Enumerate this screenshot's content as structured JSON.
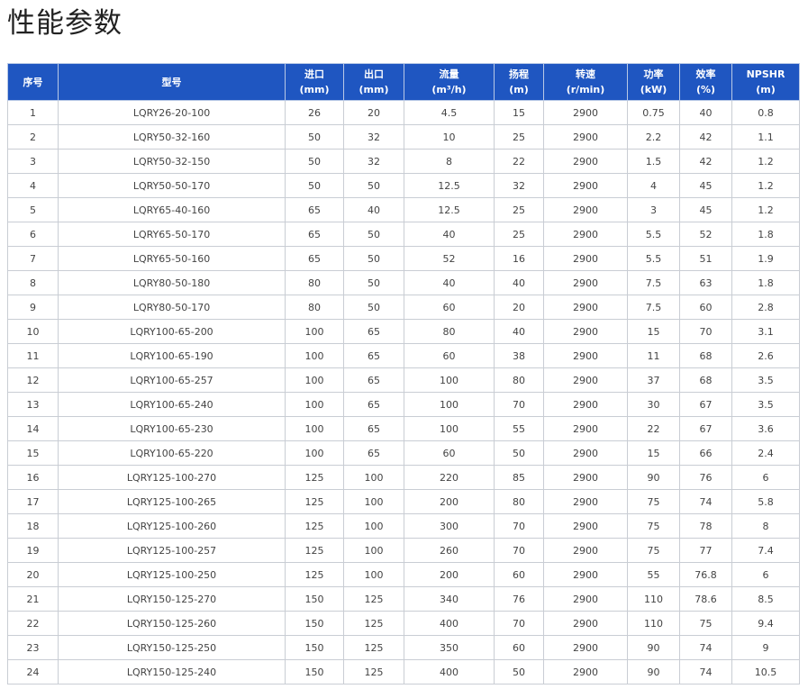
{
  "title": "性能参数",
  "columns": [
    {
      "l1": "序号",
      "l2": ""
    },
    {
      "l1": "型号",
      "l2": ""
    },
    {
      "l1": "进口",
      "l2": "(mm)"
    },
    {
      "l1": "出口",
      "l2": "(mm)"
    },
    {
      "l1": "流量",
      "l2": "(m³/h)"
    },
    {
      "l1": "扬程",
      "l2": "(m)"
    },
    {
      "l1": "转速",
      "l2": "(r/min)"
    },
    {
      "l1": "功率",
      "l2": "(kW)"
    },
    {
      "l1": "效率",
      "l2": "(%)"
    },
    {
      "l1": "NPSHR",
      "l2": "(m)"
    }
  ],
  "rows": [
    [
      "1",
      "LQRY26-20-100",
      "26",
      "20",
      "4.5",
      "15",
      "2900",
      "0.75",
      "40",
      "0.8"
    ],
    [
      "2",
      "LQRY50-32-160",
      "50",
      "32",
      "10",
      "25",
      "2900",
      "2.2",
      "42",
      "1.1"
    ],
    [
      "3",
      "LQRY50-32-150",
      "50",
      "32",
      "8",
      "22",
      "2900",
      "1.5",
      "42",
      "1.2"
    ],
    [
      "4",
      "LQRY50-50-170",
      "50",
      "50",
      "12.5",
      "32",
      "2900",
      "4",
      "45",
      "1.2"
    ],
    [
      "5",
      "LQRY65-40-160",
      "65",
      "40",
      "12.5",
      "25",
      "2900",
      "3",
      "45",
      "1.2"
    ],
    [
      "6",
      "LQRY65-50-170",
      "65",
      "50",
      "40",
      "25",
      "2900",
      "5.5",
      "52",
      "1.8"
    ],
    [
      "7",
      "LQRY65-50-160",
      "65",
      "50",
      "52",
      "16",
      "2900",
      "5.5",
      "51",
      "1.9"
    ],
    [
      "8",
      "LQRY80-50-180",
      "80",
      "50",
      "40",
      "40",
      "2900",
      "7.5",
      "63",
      "1.8"
    ],
    [
      "9",
      "LQRY80-50-170",
      "80",
      "50",
      "60",
      "20",
      "2900",
      "7.5",
      "60",
      "2.8"
    ],
    [
      "10",
      "LQRY100-65-200",
      "100",
      "65",
      "80",
      "40",
      "2900",
      "15",
      "70",
      "3.1"
    ],
    [
      "11",
      "LQRY100-65-190",
      "100",
      "65",
      "60",
      "38",
      "2900",
      "11",
      "68",
      "2.6"
    ],
    [
      "12",
      "LQRY100-65-257",
      "100",
      "65",
      "100",
      "80",
      "2900",
      "37",
      "68",
      "3.5"
    ],
    [
      "13",
      "LQRY100-65-240",
      "100",
      "65",
      "100",
      "70",
      "2900",
      "30",
      "67",
      "3.5"
    ],
    [
      "14",
      "LQRY100-65-230",
      "100",
      "65",
      "100",
      "55",
      "2900",
      "22",
      "67",
      "3.6"
    ],
    [
      "15",
      "LQRY100-65-220",
      "100",
      "65",
      "60",
      "50",
      "2900",
      "15",
      "66",
      "2.4"
    ],
    [
      "16",
      "LQRY125-100-270",
      "125",
      "100",
      "220",
      "85",
      "2900",
      "90",
      "76",
      "6"
    ],
    [
      "17",
      "LQRY125-100-265",
      "125",
      "100",
      "200",
      "80",
      "2900",
      "75",
      "74",
      "5.8"
    ],
    [
      "18",
      "LQRY125-100-260",
      "125",
      "100",
      "300",
      "70",
      "2900",
      "75",
      "78",
      "8"
    ],
    [
      "19",
      "LQRY125-100-257",
      "125",
      "100",
      "260",
      "70",
      "2900",
      "75",
      "77",
      "7.4"
    ],
    [
      "20",
      "LQRY125-100-250",
      "125",
      "100",
      "200",
      "60",
      "2900",
      "55",
      "76.8",
      "6"
    ],
    [
      "21",
      "LQRY150-125-270",
      "150",
      "125",
      "340",
      "76",
      "2900",
      "110",
      "78.6",
      "8.5"
    ],
    [
      "22",
      "LQRY150-125-260",
      "150",
      "125",
      "400",
      "70",
      "2900",
      "110",
      "75",
      "9.4"
    ],
    [
      "23",
      "LQRY150-125-250",
      "150",
      "125",
      "350",
      "60",
      "2900",
      "90",
      "74",
      "9"
    ],
    [
      "24",
      "LQRY150-125-240",
      "150",
      "125",
      "400",
      "50",
      "2900",
      "90",
      "74",
      "10.5"
    ]
  ],
  "colors": {
    "header_bg": "#1f56c1",
    "header_text": "#ffffff",
    "border": "#c9cdd4"
  }
}
